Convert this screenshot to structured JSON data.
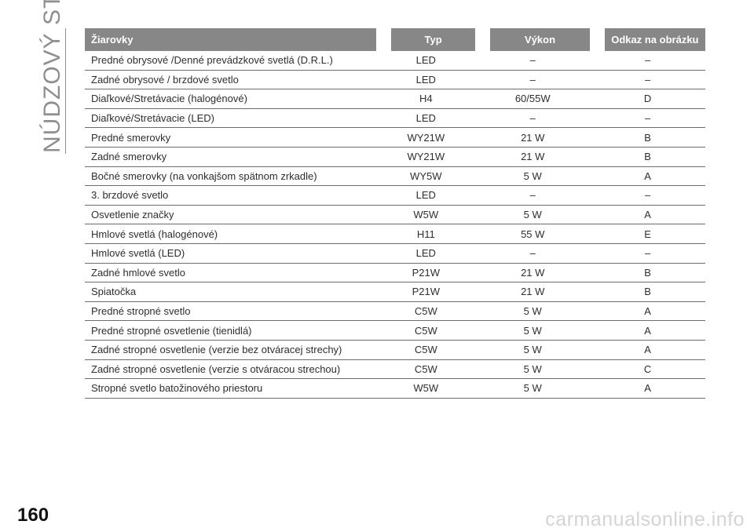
{
  "section_title": "NÚDZOVÝ STAV",
  "page_number": "160",
  "watermark": "carmanualsonline.info",
  "table": {
    "headers": {
      "name": "Žiarovky",
      "type": "Typ",
      "power": "Výkon",
      "ref": "Odkaz na obrázku"
    },
    "rows": [
      {
        "name": "Predné obrysové /Denné prevádzkové svetlá (D.R.L.)",
        "type": "LED",
        "power": "–",
        "ref": "–"
      },
      {
        "name": "Zadné obrysové / brzdové svetlo",
        "type": "LED",
        "power": "–",
        "ref": "–"
      },
      {
        "name": "Diaľkové/Stretávacie (halogénové)",
        "type": "H4",
        "power": "60/55W",
        "ref": "D"
      },
      {
        "name": "Diaľkové/Stretávacie (LED)",
        "type": "LED",
        "power": "–",
        "ref": "–"
      },
      {
        "name": "Predné smerovky",
        "type": "WY21W",
        "power": "21 W",
        "ref": "B"
      },
      {
        "name": "Zadné smerovky",
        "type": "WY21W",
        "power": "21 W",
        "ref": "B"
      },
      {
        "name": "Bočné smerovky (na vonkajšom spätnom zrkadle)",
        "type": "WY5W",
        "power": "5 W",
        "ref": "A"
      },
      {
        "name": "3. brzdové svetlo",
        "type": "LED",
        "power": "–",
        "ref": "–"
      },
      {
        "name": "Osvetlenie značky",
        "type": "W5W",
        "power": "5 W",
        "ref": "A"
      },
      {
        "name": "Hmlové svetlá (halogénové)",
        "type": "H11",
        "power": "55 W",
        "ref": "E"
      },
      {
        "name": "Hmlové svetlá (LED)",
        "type": "LED",
        "power": "–",
        "ref": "–"
      },
      {
        "name": "Zadné hmlové svetlo",
        "type": "P21W",
        "power": "21 W",
        "ref": "B"
      },
      {
        "name": "Spiatočka",
        "type": "P21W",
        "power": "21 W",
        "ref": "B"
      },
      {
        "name": "Predné stropné svetlo",
        "type": "C5W",
        "power": "5 W",
        "ref": "A"
      },
      {
        "name": "Predné stropné osvetlenie (tienidlá)",
        "type": "C5W",
        "power": "5 W",
        "ref": "A"
      },
      {
        "name": "Zadné stropné osvetlenie (verzie bez otváracej strechy)",
        "type": "C5W",
        "power": "5 W",
        "ref": "A"
      },
      {
        "name": "Zadné stropné osvetlenie (verzie s otváracou strechou)",
        "type": "C5W",
        "power": "5 W",
        "ref": "C"
      },
      {
        "name": "Stropné svetlo batožinového priestoru",
        "type": "W5W",
        "power": "5 W",
        "ref": "A"
      }
    ]
  }
}
